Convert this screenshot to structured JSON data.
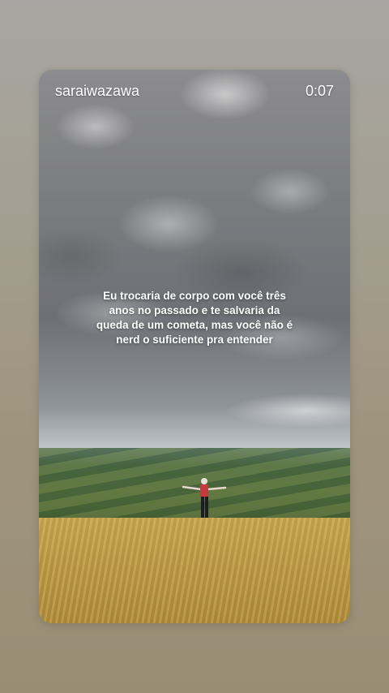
{
  "story": {
    "username": "saraiwazawa",
    "elapsed_time": "0:07",
    "caption_lines": [
      "Eu trocaria de corpo com você três",
      "anos no passado e te salvaria da",
      "queda de um cometa, mas você não é",
      "nerd o suficiente pra entender"
    ]
  }
}
